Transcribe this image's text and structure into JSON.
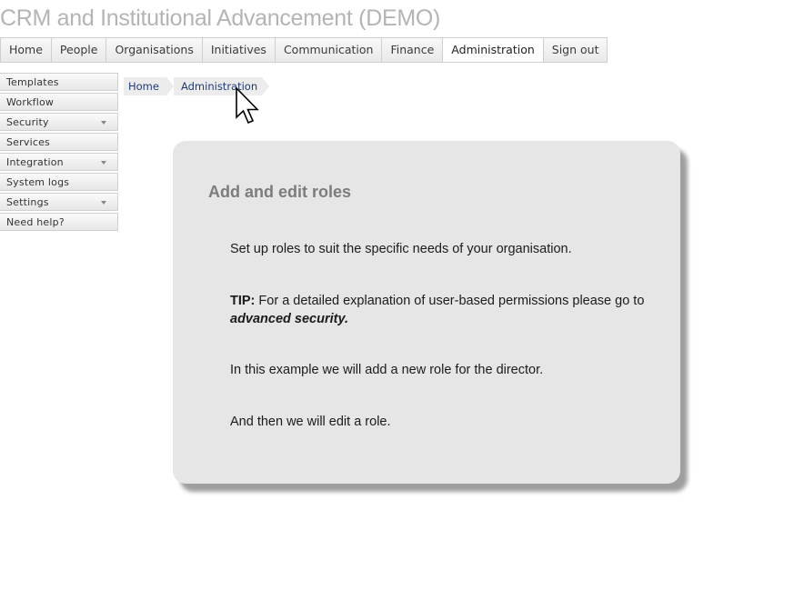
{
  "app": {
    "title": "CRM and Institutional Advancement (DEMO)"
  },
  "topnav": {
    "tabs": [
      "Home",
      "People",
      "Organisations",
      "Initiatives",
      "Communication",
      "Finance",
      "Administration",
      "Sign out"
    ],
    "active": "Administration"
  },
  "sidebar": {
    "items": [
      {
        "label": "Templates",
        "has_dropdown": false
      },
      {
        "label": "Workflow",
        "has_dropdown": false
      },
      {
        "label": "Security",
        "has_dropdown": true
      },
      {
        "label": "Services",
        "has_dropdown": false
      },
      {
        "label": "Integration",
        "has_dropdown": true
      },
      {
        "label": "System logs",
        "has_dropdown": false
      },
      {
        "label": "Settings",
        "has_dropdown": true
      },
      {
        "label": "Need help?",
        "has_dropdown": false
      }
    ]
  },
  "breadcrumb": {
    "items": [
      "Home",
      "Administration"
    ]
  },
  "card": {
    "heading": "Add and edit roles",
    "para1": "Set up roles to suit the specific needs of your organisation.",
    "tip_label": "TIP:",
    "tip_text": " For a detailed explanation of user-based permissions please go to ",
    "tip_link": "advanced security.",
    "para3": "In this example we will add a new role for the director.",
    "para4": "And then we will edit a role."
  },
  "icons": {
    "cursor": "mouse-pointer-icon",
    "dropdown": "chevron-down-icon"
  },
  "colors": {
    "title": "#b4b4b4",
    "card_bg": "#e6e6e6",
    "link": "#1f3a7a",
    "heading": "#7c7c7c"
  }
}
